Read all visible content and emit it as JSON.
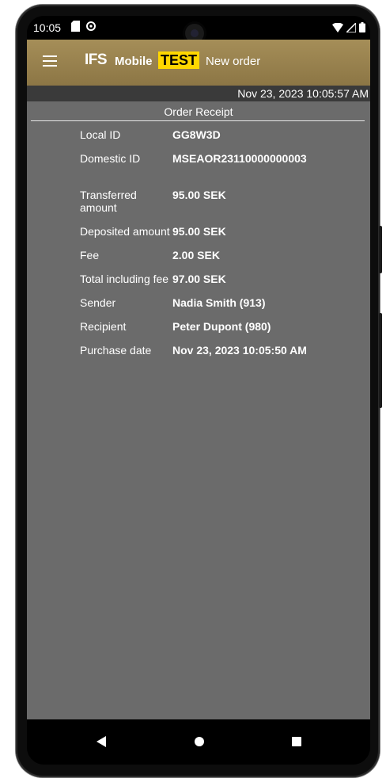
{
  "status_bar": {
    "time": "10:05",
    "left_icons": [
      "sd-card-icon",
      "sync-icon"
    ],
    "right_icons": [
      "wifi-icon",
      "signal-icon",
      "battery-icon"
    ]
  },
  "app_bar": {
    "logo": {
      "brand": "IFS",
      "product": "Mobile",
      "env_badge": "TEST"
    },
    "title": "New order",
    "colors": {
      "bar": "#a58e58",
      "badge": "#ffd700"
    }
  },
  "timestamp": "Nov 23, 2023 10:05:57 AM",
  "receipt": {
    "title": "Order Receipt",
    "rows": [
      {
        "label": "Local ID",
        "value": "GG8W3D"
      },
      {
        "label": "Domestic ID",
        "value": "MSEAOR23110000000003"
      },
      {
        "label": "Transferred amount",
        "value": "95.00 SEK"
      },
      {
        "label": "Deposited amount",
        "value": "95.00 SEK"
      },
      {
        "label": "Fee",
        "value": "2.00 SEK"
      },
      {
        "label": "Total including fee",
        "value": "97.00 SEK"
      },
      {
        "label": "Sender",
        "value": "Nadia Smith (913)"
      },
      {
        "label": "Recipient",
        "value": "Peter Dupont (980)"
      },
      {
        "label": "Purchase date",
        "value": "Nov 23, 2023 10:05:50 AM"
      }
    ]
  },
  "nav": {
    "back": "back-icon",
    "home": "home-icon",
    "recents": "recents-icon"
  }
}
